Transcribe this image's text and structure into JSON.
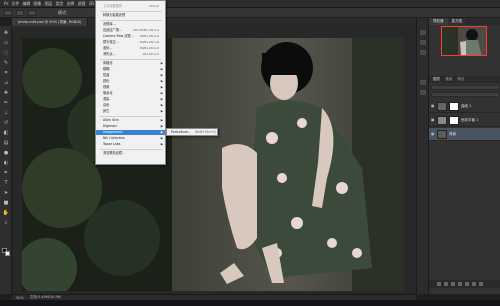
{
  "menubar": {
    "items": [
      "Ps",
      "文件",
      "编辑",
      "图像",
      "图层",
      "类型",
      "选择",
      "滤镜",
      "3D",
      "视图",
      "窗口",
      "帮助"
    ]
  },
  "optionsbar": {
    "label": "模式:"
  },
  "document": {
    "tab_title": "photo-edit.psd @ 50% (背景, RGB/8)"
  },
  "status": {
    "zoom": "50%",
    "doc_info": "文档:5.49M/10.9M"
  },
  "navigator": {
    "tab": "导航器",
    "tab2": "直方图"
  },
  "layers": {
    "tab": "图层",
    "tab2": "通道",
    "tab3": "路径",
    "rows": [
      {
        "name": "曲线 1"
      },
      {
        "name": "色彩平衡 1"
      },
      {
        "name": "背景"
      }
    ]
  },
  "filter_menu": {
    "items": [
      {
        "label": "上次滤镜操作",
        "shortcut": "Ctrl+F",
        "dim": true
      },
      {
        "label": "转换为智能滤镜",
        "dim": false
      },
      {
        "label": "滤镜库...",
        "dim": false
      },
      {
        "label": "自适应广角...",
        "shortcut": "Alt+Shift+Ctrl+A",
        "dim": false
      },
      {
        "label": "Camera Raw 滤镜...",
        "shortcut": "Shift+Ctrl+A",
        "dim": false
      },
      {
        "label": "镜头校正...",
        "shortcut": "Shift+Ctrl+R",
        "dim": false
      },
      {
        "label": "液化...",
        "shortcut": "Shift+Ctrl+X",
        "dim": false
      },
      {
        "label": "消失点...",
        "shortcut": "Alt+Ctrl+V",
        "dim": false
      },
      {
        "label": "风格化",
        "arrow": "▶"
      },
      {
        "label": "模糊",
        "arrow": "▶"
      },
      {
        "label": "扭曲",
        "arrow": "▶"
      },
      {
        "label": "锐化",
        "arrow": "▶"
      },
      {
        "label": "视频",
        "arrow": "▶"
      },
      {
        "label": "像素化",
        "arrow": "▶"
      },
      {
        "label": "渲染",
        "arrow": "▶"
      },
      {
        "label": "杂色",
        "arrow": "▶"
      },
      {
        "label": "其它",
        "arrow": "▶"
      },
      {
        "label": "Alien Skin",
        "arrow": "▶"
      },
      {
        "label": "Digimarc",
        "arrow": "▶"
      },
      {
        "label": "Imagenomic",
        "arrow": "▶"
      },
      {
        "label": "Nik Collection",
        "arrow": "▶"
      },
      {
        "label": "Topaz Labs",
        "arrow": "▶"
      },
      {
        "label": "浏览联机滤镜..."
      }
    ],
    "highlighted_index": 19
  },
  "submenu": {
    "item": "Portraiture...",
    "shortcut": "Shift+Ctrl+Q"
  },
  "colors": {
    "accent": "#3b83d0",
    "nav_border": "#ff3a2e"
  }
}
